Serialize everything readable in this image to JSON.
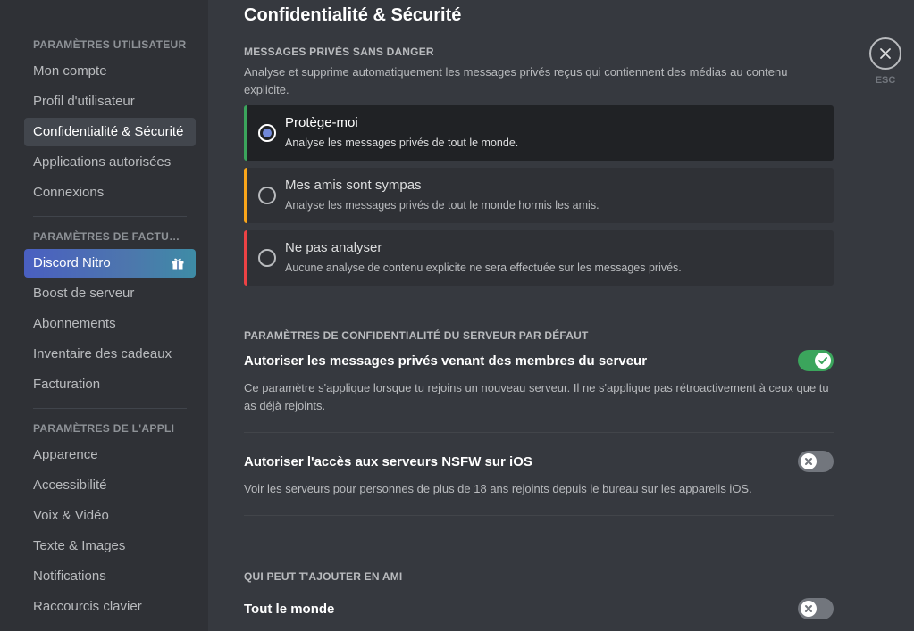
{
  "sidebar": {
    "sections": [
      {
        "header": "PARAMÈTRES UTILISATEUR"
      },
      {
        "header": "PARAMÈTRES DE FACTURATION"
      },
      {
        "header": "PARAMÈTRES DE L'APPLI"
      }
    ],
    "items": [
      {
        "label": "Mon compte"
      },
      {
        "label": "Profil d'utilisateur"
      },
      {
        "label": "Confidentialité & Sécurité"
      },
      {
        "label": "Applications autorisées"
      },
      {
        "label": "Connexions"
      },
      {
        "label": "Discord Nitro"
      },
      {
        "label": "Boost de serveur"
      },
      {
        "label": "Abonnements"
      },
      {
        "label": "Inventaire des cadeaux"
      },
      {
        "label": "Facturation"
      },
      {
        "label": "Apparence"
      },
      {
        "label": "Accessibilité"
      },
      {
        "label": "Voix & Vidéo"
      },
      {
        "label": "Texte & Images"
      },
      {
        "label": "Notifications"
      },
      {
        "label": "Raccourcis clavier"
      }
    ],
    "active_item": "Confidentialité & Sécurité"
  },
  "main": {
    "title": "Confidentialité & Sécurité",
    "safe_dm": {
      "header": "MESSAGES PRIVÉS SANS DANGER",
      "description": "Analyse et supprime automatiquement les messages privés reçus qui contiennent des médias au contenu explicite.",
      "options": [
        {
          "title": "Protège-moi",
          "subtitle": "Analyse les messages privés de tout le monde.",
          "selected": true,
          "accent": "#3ba55c"
        },
        {
          "title": "Mes amis sont sympas",
          "subtitle": "Analyse les messages privés de tout le monde hormis les amis.",
          "selected": false,
          "accent": "#faa61a"
        },
        {
          "title": "Ne pas analyser",
          "subtitle": "Aucune analyse de contenu explicite ne sera effectuée sur les messages privés.",
          "selected": false,
          "accent": "#ed4245"
        }
      ]
    },
    "server_privacy": {
      "header": "PARAMÈTRES DE CONFIDENTIALITÉ DU SERVEUR PAR DÉFAUT",
      "settings": [
        {
          "title": "Autoriser les messages privés venant des membres du serveur",
          "description": "Ce paramètre s'applique lorsque tu rejoins un nouveau serveur. Il ne s'applique pas rétroactivement à ceux que tu as déjà rejoints.",
          "enabled": true
        },
        {
          "title": "Autoriser l'accès aux serveurs NSFW sur iOS",
          "description": "Voir les serveurs pour personnes de plus de 18 ans rejoints depuis le bureau sur les appareils iOS.",
          "enabled": false
        }
      ]
    },
    "friend_requests": {
      "header": "QUI PEUT T'AJOUTER EN AMI",
      "settings": [
        {
          "title": "Tout le monde",
          "enabled": false
        }
      ]
    }
  },
  "close": {
    "label": "ESC"
  },
  "colors": {
    "background": "#36393f",
    "sidebar": "#2f3136",
    "toggle_on": "#3ba55c",
    "toggle_off": "#72767d",
    "radio_selected": "#7289da"
  }
}
